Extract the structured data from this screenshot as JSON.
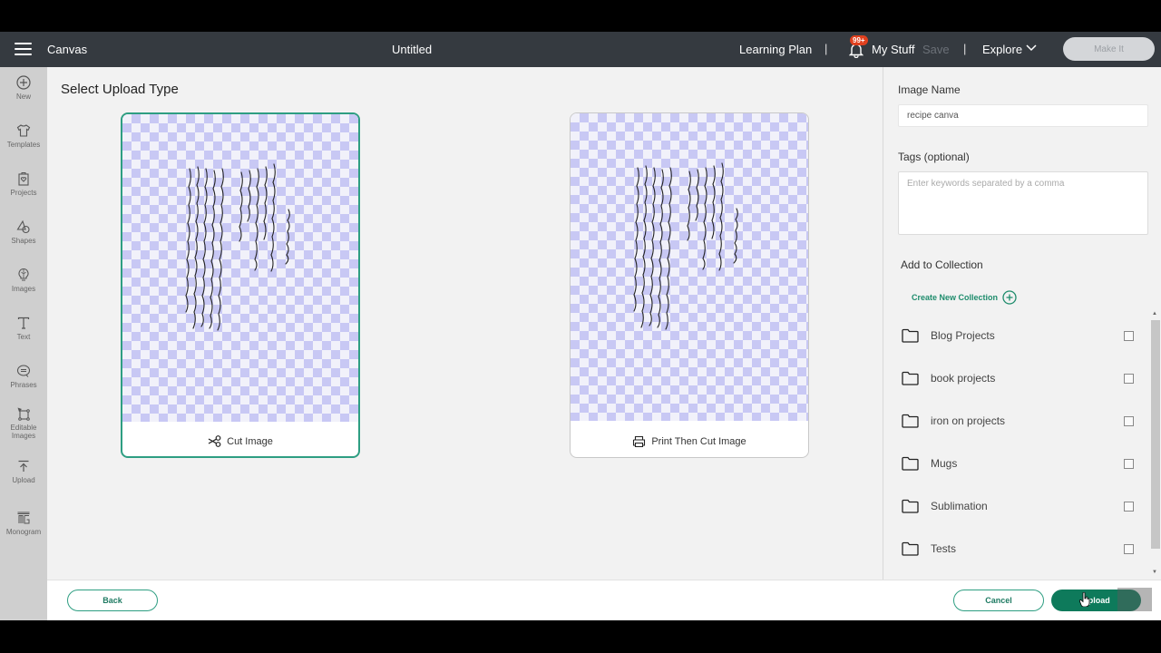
{
  "header": {
    "app_section": "Canvas",
    "title": "Untitled",
    "learning_plan": "Learning Plan",
    "separator": "|",
    "notification_badge": "99+",
    "my_stuff": "My Stuff",
    "save": "Save",
    "explore": "Explore",
    "make_it": "Make It"
  },
  "sidebar": {
    "items": [
      {
        "label": "New",
        "icon": "plus-circle-icon"
      },
      {
        "label": "Templates",
        "icon": "tshirt-icon"
      },
      {
        "label": "Projects",
        "icon": "projects-icon"
      },
      {
        "label": "Shapes",
        "icon": "shapes-icon"
      },
      {
        "label": "Images",
        "icon": "lightbulb-icon"
      },
      {
        "label": "Text",
        "icon": "text-icon"
      },
      {
        "label": "Phrases",
        "icon": "speech-bubble-icon"
      },
      {
        "label": "Editable",
        "label2": "Images",
        "icon": "editable-images-icon"
      },
      {
        "label": "Upload",
        "icon": "upload-icon"
      },
      {
        "label": "Monogram",
        "icon": "monogram-icon"
      }
    ]
  },
  "main": {
    "title": "Select Upload Type",
    "cards": [
      {
        "label": "Cut Image",
        "icon": "scissors-icon",
        "selected": true
      },
      {
        "label": "Print Then Cut Image",
        "icon": "printer-icon",
        "selected": false
      }
    ]
  },
  "panel": {
    "image_name_label": "Image Name",
    "image_name_value": "recipe canva",
    "tags_label": "Tags (optional)",
    "tags_placeholder": "Enter keywords separated by a comma",
    "collection_label": "Add to Collection",
    "create_collection": "Create New Collection",
    "collections": [
      {
        "name": "Blog Projects",
        "checked": false
      },
      {
        "name": "book projects",
        "checked": false
      },
      {
        "name": "iron on projects",
        "checked": false
      },
      {
        "name": "Mugs",
        "checked": false
      },
      {
        "name": "Sublimation",
        "checked": false
      },
      {
        "name": "Tests",
        "checked": false
      }
    ]
  },
  "footer": {
    "back": "Back",
    "cancel": "Cancel",
    "upload": "Upload"
  },
  "colors": {
    "accent": "#0e7a5b",
    "accent_border": "#2e9e82",
    "header_bg": "#353a40",
    "badge": "#e0401e"
  }
}
